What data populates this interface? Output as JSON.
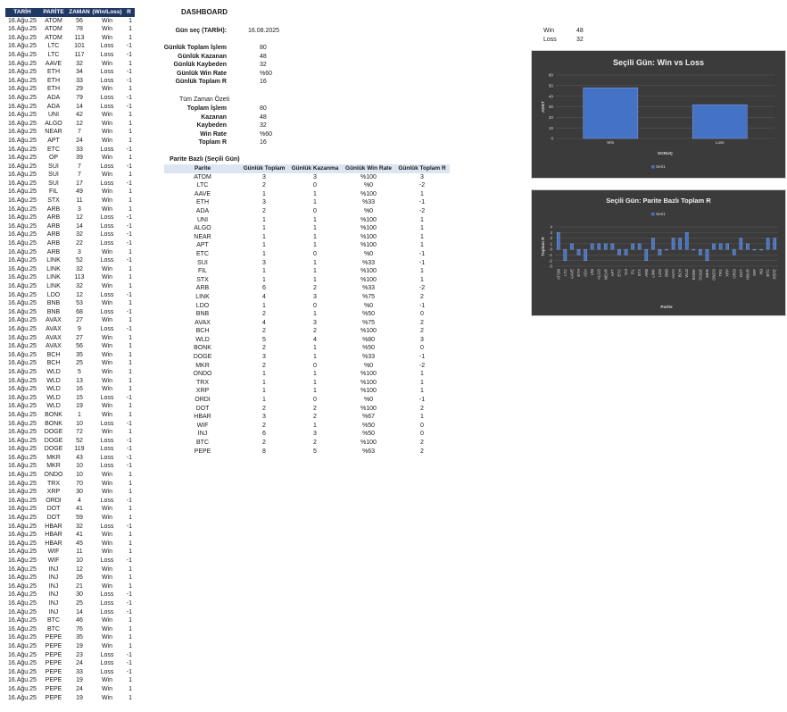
{
  "dashboard": {
    "title": "DASHBOARD",
    "date_label": "Gün seç (TARİH):",
    "date_value": "16.08.2025"
  },
  "daily": {
    "items": [
      {
        "label": "Günlük Toplam İşlem",
        "value": "80"
      },
      {
        "label": "Günlük Kazanan",
        "value": "48"
      },
      {
        "label": "Günlük Kaybeden",
        "value": "32"
      },
      {
        "label": "Günlük Win Rate",
        "value": "%60"
      },
      {
        "label": "Günlük Toplam R",
        "value": "16"
      }
    ]
  },
  "alltime": {
    "title": "Tüm Zaman Özeti",
    "items": [
      {
        "label": "Toplam İşlem",
        "value": "80"
      },
      {
        "label": "Kazanan",
        "value": "48"
      },
      {
        "label": "Kaybeden",
        "value": "32"
      },
      {
        "label": "Win Rate",
        "value": "%60"
      },
      {
        "label": "Toplam R",
        "value": "16"
      }
    ]
  },
  "summary": {
    "items": [
      {
        "label": "Win",
        "value": "48"
      },
      {
        "label": "Loss",
        "value": "32"
      }
    ]
  },
  "trades": {
    "headers": [
      "TARİH",
      "PARİTE",
      "ZAMAN",
      "(Win/Loss)",
      "R"
    ],
    "rows": [
      [
        "16.Ağu.25",
        "ATOM",
        "56",
        "Win",
        "1"
      ],
      [
        "16.Ağu.25",
        "ATOM",
        "78",
        "Win",
        "1"
      ],
      [
        "16.Ağu.25",
        "ATOM",
        "113",
        "Win",
        "1"
      ],
      [
        "16.Ağu.25",
        "LTC",
        "101",
        "Loss",
        "-1"
      ],
      [
        "16.Ağu.25",
        "LTC",
        "117",
        "Loss",
        "-1"
      ],
      [
        "16.Ağu.25",
        "AAVE",
        "32",
        "Win",
        "1"
      ],
      [
        "16.Ağu.25",
        "ETH",
        "34",
        "Loss",
        "-1"
      ],
      [
        "16.Ağu.25",
        "ETH",
        "33",
        "Loss",
        "-1"
      ],
      [
        "16.Ağu.25",
        "ETH",
        "29",
        "Win",
        "1"
      ],
      [
        "16.Ağu.25",
        "ADA",
        "79",
        "Loss",
        "-1"
      ],
      [
        "16.Ağu.25",
        "ADA",
        "14",
        "Loss",
        "-1"
      ],
      [
        "16.Ağu.25",
        "UNI",
        "42",
        "Win",
        "1"
      ],
      [
        "16.Ağu.25",
        "ALGO",
        "12",
        "Win",
        "1"
      ],
      [
        "16.Ağu.25",
        "NEAR",
        "7",
        "Win",
        "1"
      ],
      [
        "16.Ağu.25",
        "APT",
        "24",
        "Win",
        "1"
      ],
      [
        "16.Ağu.25",
        "ETC",
        "33",
        "Loss",
        "-1"
      ],
      [
        "16.Ağu.25",
        "OP",
        "39",
        "Win",
        "1"
      ],
      [
        "16.Ağu.25",
        "SUI",
        "7",
        "Loss",
        "-1"
      ],
      [
        "16.Ağu.25",
        "SUI",
        "7",
        "Win",
        "1"
      ],
      [
        "16.Ağu.25",
        "SUI",
        "17",
        "Loss",
        "-1"
      ],
      [
        "16.Ağu.25",
        "FIL",
        "49",
        "Win",
        "1"
      ],
      [
        "16.Ağu.25",
        "STX",
        "11",
        "Win",
        "1"
      ],
      [
        "16.Ağu.25",
        "ARB",
        "3",
        "Win",
        "1"
      ],
      [
        "16.Ağu.25",
        "ARB",
        "12",
        "Loss",
        "-1"
      ],
      [
        "16.Ağu.25",
        "ARB",
        "14",
        "Loss",
        "-1"
      ],
      [
        "16.Ağu.25",
        "ARB",
        "32",
        "Loss",
        "-1"
      ],
      [
        "16.Ağu.25",
        "ARB",
        "22",
        "Loss",
        "-1"
      ],
      [
        "16.Ağu.25",
        "ARB",
        "3",
        "Win",
        "1"
      ],
      [
        "16.Ağu.25",
        "LINK",
        "52",
        "Loss",
        "-1"
      ],
      [
        "16.Ağu.25",
        "LINK",
        "32",
        "Win",
        "1"
      ],
      [
        "16.Ağu.25",
        "LINK",
        "113",
        "Win",
        "1"
      ],
      [
        "16.Ağu.25",
        "LINK",
        "32",
        "Win",
        "1"
      ],
      [
        "16.Ağu.25",
        "LDO",
        "12",
        "Loss",
        "-1"
      ],
      [
        "16.Ağu.25",
        "BNB",
        "53",
        "Win",
        "1"
      ],
      [
        "16.Ağu.25",
        "BNB",
        "68",
        "Loss",
        "-1"
      ],
      [
        "16.Ağu.25",
        "AVAX",
        "27",
        "Win",
        "1"
      ],
      [
        "16.Ağu.25",
        "AVAX",
        "9",
        "Loss",
        "-1"
      ],
      [
        "16.Ağu.25",
        "AVAX",
        "27",
        "Win",
        "1"
      ],
      [
        "16.Ağu.25",
        "AVAX",
        "56",
        "Win",
        "1"
      ],
      [
        "16.Ağu.25",
        "BCH",
        "35",
        "Win",
        "1"
      ],
      [
        "16.Ağu.25",
        "BCH",
        "25",
        "Win",
        "1"
      ],
      [
        "16.Ağu.25",
        "WLD",
        "5",
        "Win",
        "1"
      ],
      [
        "16.Ağu.25",
        "WLD",
        "13",
        "Win",
        "1"
      ],
      [
        "16.Ağu.25",
        "WLD",
        "16",
        "Win",
        "1"
      ],
      [
        "16.Ağu.25",
        "WLD",
        "15",
        "Loss",
        "-1"
      ],
      [
        "16.Ağu.25",
        "WLD",
        "19",
        "Win",
        "1"
      ],
      [
        "16.Ağu.25",
        "BONK",
        "1",
        "Win",
        "1"
      ],
      [
        "16.Ağu.25",
        "BONK",
        "10",
        "Loss",
        "-1"
      ],
      [
        "16.Ağu.25",
        "DOGE",
        "72",
        "Win",
        "1"
      ],
      [
        "16.Ağu.25",
        "DOGE",
        "52",
        "Loss",
        "-1"
      ],
      [
        "16.Ağu.25",
        "DOGE",
        "119",
        "Loss",
        "-1"
      ],
      [
        "16.Ağu.25",
        "MKR",
        "43",
        "Loss",
        "-1"
      ],
      [
        "16.Ağu.25",
        "MKR",
        "10",
        "Loss",
        "-1"
      ],
      [
        "16.Ağu.25",
        "ONDO",
        "10",
        "Win",
        "1"
      ],
      [
        "16.Ağu.25",
        "TRX",
        "70",
        "Win",
        "1"
      ],
      [
        "16.Ağu.25",
        "XRP",
        "30",
        "Win",
        "1"
      ],
      [
        "16.Ağu.25",
        "ORDI",
        "4",
        "Loss",
        "-1"
      ],
      [
        "16.Ağu.25",
        "DOT",
        "41",
        "Win",
        "1"
      ],
      [
        "16.Ağu.25",
        "DOT",
        "59",
        "Win",
        "1"
      ],
      [
        "16.Ağu.25",
        "HBAR",
        "32",
        "Loss",
        "-1"
      ],
      [
        "16.Ağu.25",
        "HBAR",
        "41",
        "Win",
        "1"
      ],
      [
        "16.Ağu.25",
        "HBAR",
        "45",
        "Win",
        "1"
      ],
      [
        "16.Ağu.25",
        "WIF",
        "11",
        "Win",
        "1"
      ],
      [
        "16.Ağu.25",
        "WIF",
        "10",
        "Loss",
        "-1"
      ],
      [
        "16.Ağu.25",
        "INJ",
        "12",
        "Win",
        "1"
      ],
      [
        "16.Ağu.25",
        "INJ",
        "26",
        "Win",
        "1"
      ],
      [
        "16.Ağu.25",
        "INJ",
        "21",
        "Win",
        "1"
      ],
      [
        "16.Ağu.25",
        "INJ",
        "30",
        "Loss",
        "-1"
      ],
      [
        "16.Ağu.25",
        "INJ",
        "25",
        "Loss",
        "-1"
      ],
      [
        "16.Ağu.25",
        "INJ",
        "14",
        "Loss",
        "-1"
      ],
      [
        "16.Ağu.25",
        "BTC",
        "46",
        "Win",
        "1"
      ],
      [
        "16.Ağu.25",
        "BTC",
        "76",
        "Win",
        "1"
      ],
      [
        "16.Ağu.25",
        "PEPE",
        "35",
        "Win",
        "1"
      ],
      [
        "16.Ağu.25",
        "PEPE",
        "19",
        "Win",
        "1"
      ],
      [
        "16.Ağu.25",
        "PEPE",
        "23",
        "Loss",
        "-1"
      ],
      [
        "16.Ağu.25",
        "PEPE",
        "24",
        "Loss",
        "-1"
      ],
      [
        "16.Ağu.25",
        "PEPE",
        "33",
        "Loss",
        "-1"
      ],
      [
        "16.Ağu.25",
        "PEPE",
        "19",
        "Win",
        "1"
      ],
      [
        "16.Ağu.25",
        "PEPE",
        "24",
        "Win",
        "1"
      ],
      [
        "16.Ağu.25",
        "PEPE",
        "19",
        "Win",
        "1"
      ]
    ]
  },
  "pair_table": {
    "title": "Parite Bazlı (Seçili Gün)",
    "headers": [
      "Parite",
      "Günlük Toplam",
      "Günlük Kazanma",
      "Günlük Win Rate",
      "Günlük Toplam R"
    ],
    "rows": [
      [
        "ATOM",
        "3",
        "3",
        "%100",
        "3"
      ],
      [
        "LTC",
        "2",
        "0",
        "%0",
        "-2"
      ],
      [
        "AAVE",
        "1",
        "1",
        "%100",
        "1"
      ],
      [
        "ETH",
        "3",
        "1",
        "%33",
        "-1"
      ],
      [
        "ADA",
        "2",
        "0",
        "%0",
        "-2"
      ],
      [
        "UNI",
        "1",
        "1",
        "%100",
        "1"
      ],
      [
        "ALGO",
        "1",
        "1",
        "%100",
        "1"
      ],
      [
        "NEAR",
        "1",
        "1",
        "%100",
        "1"
      ],
      [
        "APT",
        "1",
        "1",
        "%100",
        "1"
      ],
      [
        "ETC",
        "1",
        "0",
        "%0",
        "-1"
      ],
      [
        "SUI",
        "3",
        "1",
        "%33",
        "-1"
      ],
      [
        "FIL",
        "1",
        "1",
        "%100",
        "1"
      ],
      [
        "STX",
        "1",
        "1",
        "%100",
        "1"
      ],
      [
        "ARB",
        "6",
        "2",
        "%33",
        "-2"
      ],
      [
        "LINK",
        "4",
        "3",
        "%75",
        "2"
      ],
      [
        "LDO",
        "1",
        "0",
        "%0",
        "-1"
      ],
      [
        "BNB",
        "2",
        "1",
        "%50",
        "0"
      ],
      [
        "AVAX",
        "4",
        "3",
        "%75",
        "2"
      ],
      [
        "BCH",
        "2",
        "2",
        "%100",
        "2"
      ],
      [
        "WLD",
        "5",
        "4",
        "%80",
        "3"
      ],
      [
        "BONK",
        "2",
        "1",
        "%50",
        "0"
      ],
      [
        "DOGE",
        "3",
        "1",
        "%33",
        "-1"
      ],
      [
        "MKR",
        "2",
        "0",
        "%0",
        "-2"
      ],
      [
        "ONDO",
        "1",
        "1",
        "%100",
        "1"
      ],
      [
        "TRX",
        "1",
        "1",
        "%100",
        "1"
      ],
      [
        "XRP",
        "1",
        "1",
        "%100",
        "1"
      ],
      [
        "ORDI",
        "1",
        "0",
        "%0",
        "-1"
      ],
      [
        "DOT",
        "2",
        "2",
        "%100",
        "2"
      ],
      [
        "HBAR",
        "3",
        "2",
        "%67",
        "1"
      ],
      [
        "WIF",
        "2",
        "1",
        "%50",
        "0"
      ],
      [
        "INJ",
        "6",
        "3",
        "%50",
        "0"
      ],
      [
        "BTC",
        "2",
        "2",
        "%100",
        "2"
      ],
      [
        "PEPE",
        "8",
        "5",
        "%63",
        "2"
      ]
    ]
  },
  "chart_data": [
    {
      "type": "bar",
      "title": "Seçili Gün: Win vs Loss",
      "xlabel": "SONUÇ",
      "ylabel": "ADET",
      "categories": [
        "Win",
        "Loss"
      ],
      "values": [
        48,
        32
      ],
      "ylim": [
        0,
        60
      ],
      "yticks": [
        "0",
        "10",
        "20",
        "30",
        "40",
        "50",
        "60"
      ],
      "grid": true,
      "legend": "bottom",
      "series": [
        {
          "name": "Seri1",
          "values": [
            48,
            32
          ]
        }
      ],
      "color": "#4472c4"
    },
    {
      "type": "bar",
      "title": "Seçili Gün: Parite Bazlı Toplam R",
      "xlabel": "Parite",
      "ylabel": "Toplam R",
      "categories": [
        "ATOM",
        "LTC",
        "AAVE",
        "ETH",
        "ADA",
        "UNI",
        "ALGO",
        "NEAR",
        "APT",
        "ETC",
        "SUI",
        "FIL",
        "STX",
        "ARB",
        "LINK",
        "LDO",
        "BNB",
        "AVAX",
        "BCH",
        "WLD",
        "BONK",
        "DOGE",
        "MKR",
        "ONDO",
        "TRX",
        "XRP",
        "ORDI",
        "DOT",
        "HBAR",
        "WIF",
        "INJ",
        "BTC",
        "PEPE"
      ],
      "values": [
        3,
        -2,
        1,
        -1,
        -2,
        1,
        1,
        1,
        1,
        -1,
        -1,
        1,
        1,
        -2,
        2,
        -1,
        0,
        2,
        2,
        3,
        0,
        -1,
        -2,
        1,
        1,
        1,
        -1,
        2,
        1,
        0,
        0,
        2,
        2
      ],
      "ylim": [
        -3,
        4
      ],
      "yticks": [
        "-3",
        "-2",
        "-1",
        "0",
        "1",
        "2",
        "3",
        "4"
      ],
      "grid": true,
      "legend": "top",
      "series": [
        {
          "name": "Seri1",
          "values": [
            3,
            -2,
            1,
            -1,
            -2,
            1,
            1,
            1,
            1,
            -1,
            -1,
            1,
            1,
            -2,
            2,
            -1,
            0,
            2,
            2,
            3,
            0,
            -1,
            -2,
            1,
            1,
            1,
            -1,
            2,
            1,
            0,
            0,
            2,
            2
          ]
        }
      ],
      "color": "#4472c4"
    }
  ]
}
